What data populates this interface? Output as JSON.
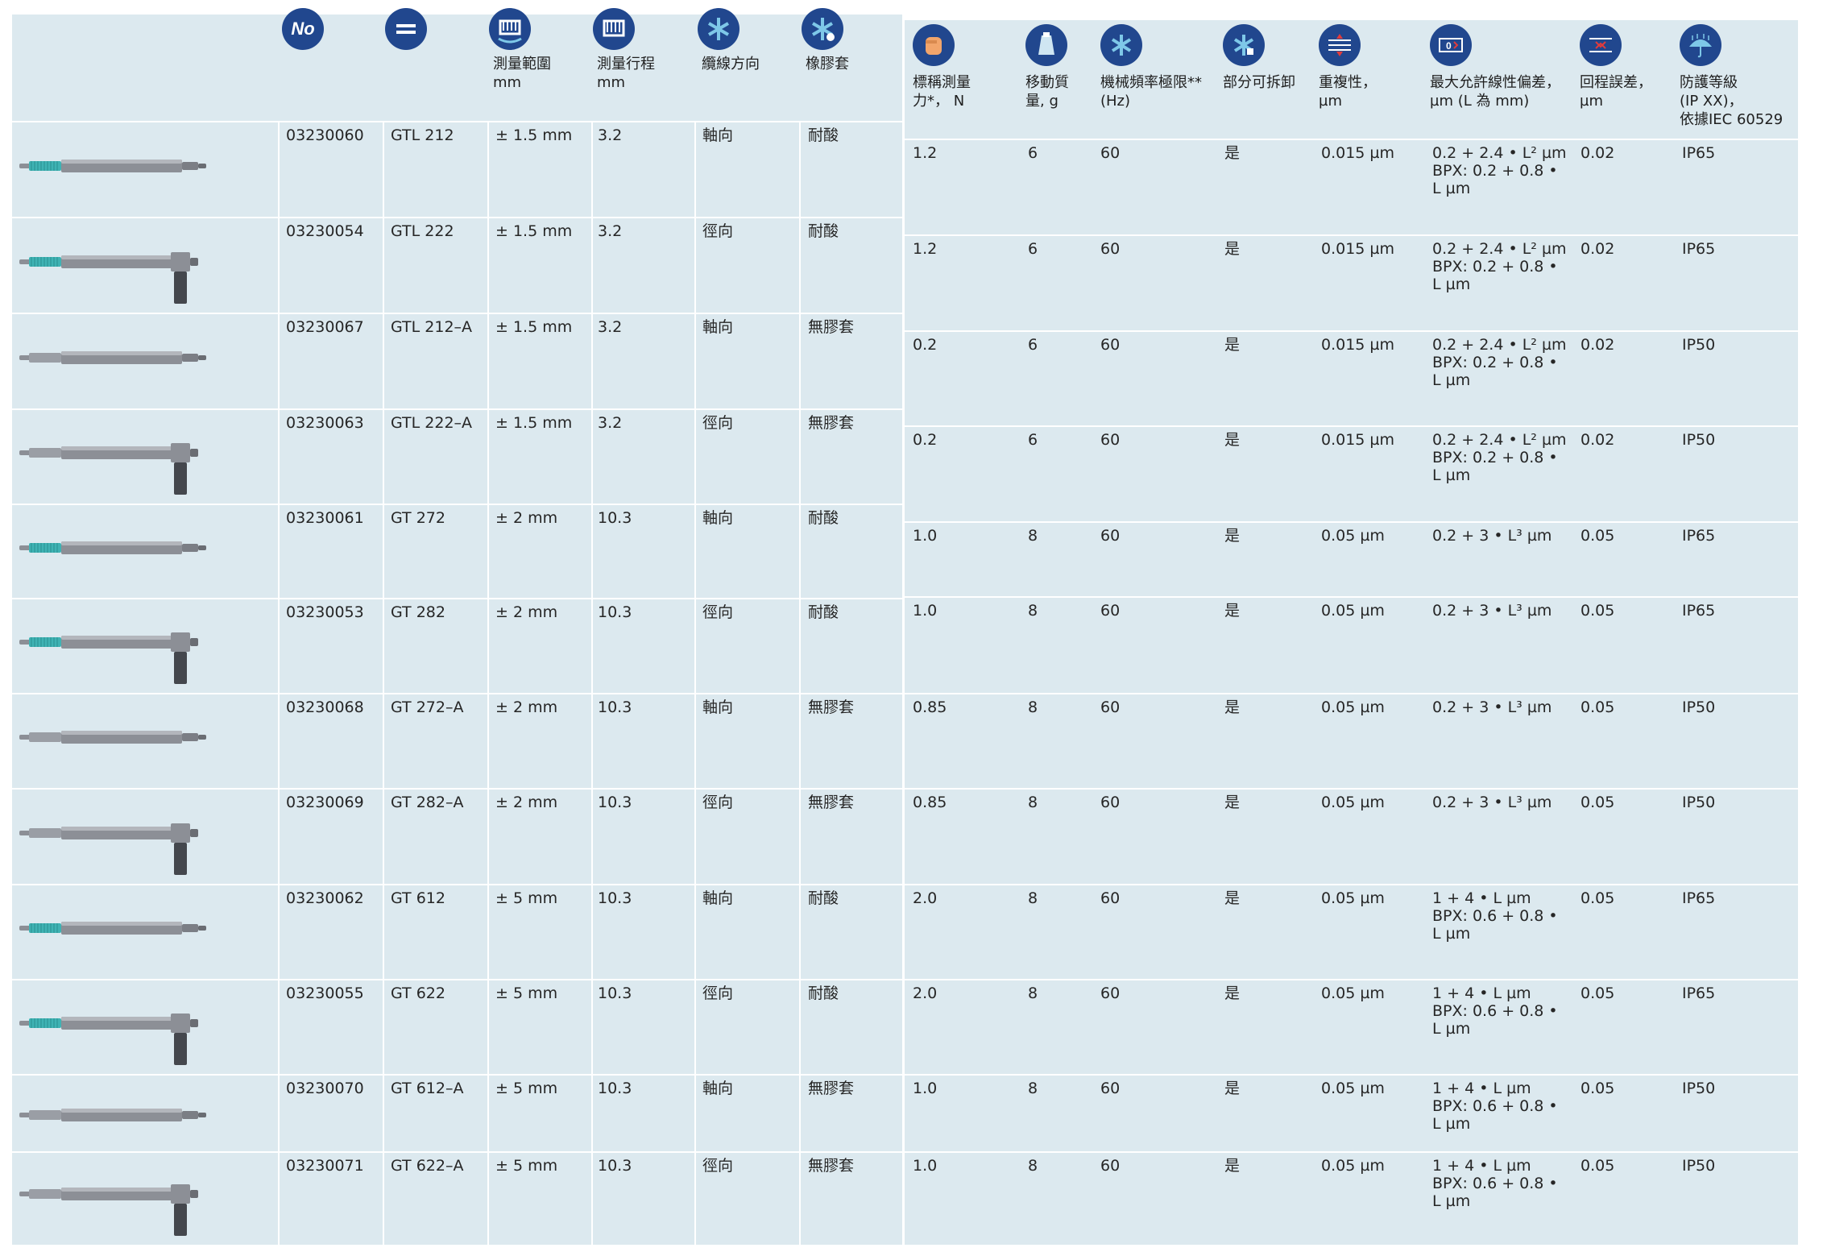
{
  "colors": {
    "panel": "#dce9ef",
    "icon": "#21478e",
    "gaiter": "#3fb3b4",
    "probe_body": "#8c8f96"
  },
  "icons": [
    "number-icon",
    "model-icon",
    "range-icon",
    "stroke-icon",
    "cable-icon",
    "gaiter-icon",
    "force-icon",
    "mass-icon",
    "frequency-icon",
    "removable-icon",
    "repeatability-icon",
    "linearity-icon",
    "hysteresis-icon",
    "protection-icon"
  ],
  "left_headers": {
    "range": "測量範圍\nmm",
    "stroke": "測量行程\nmm",
    "cable": "纜線方向",
    "gaiter": "橡膠套"
  },
  "right_headers": {
    "force": "標稱測量\n力*， N",
    "mass": "移動質\n量, g",
    "freq": "機械頻率極限**\n(Hz)",
    "removable": "部分可拆卸",
    "repeat": "重複性，\nµm",
    "linearity": "最大允許線性偏差，\nµm (L 為 mm)",
    "hysteresis": "回程誤差，\nµm",
    "protection": "防護等級\n(IP XX)，\n依據IEC 60529"
  },
  "rows": [
    {
      "no": "03230060",
      "model": "GTL 212",
      "range": "± 1.5 mm",
      "stroke": "3.2",
      "cable": "軸向",
      "gaiter": "耐酸",
      "force": "1.2",
      "mass": "6",
      "freq": "60",
      "removable": "是",
      "repeat": "0.015 µm",
      "linearity": "0.2 + 2.4 • L² µm\nBPX: 0.2 + 0.8 •\nL µm",
      "hysteresis": "0.02",
      "protection": "IP65",
      "probe_type": "axial",
      "gaiter_on": true
    },
    {
      "no": "03230054",
      "model": "GTL 222",
      "range": "± 1.5 mm",
      "stroke": "3.2",
      "cable": "徑向",
      "gaiter": "耐酸",
      "force": "1.2",
      "mass": "6",
      "freq": "60",
      "removable": "是",
      "repeat": "0.015 µm",
      "linearity": "0.2 + 2.4 • L² µm\nBPX: 0.2 + 0.8 •\nL µm",
      "hysteresis": "0.02",
      "protection": "IP65",
      "probe_type": "radial",
      "gaiter_on": true
    },
    {
      "no": "03230067",
      "model": "GTL 212–A",
      "range": "± 1.5 mm",
      "stroke": "3.2",
      "cable": "軸向",
      "gaiter": "無膠套",
      "force": "0.2",
      "mass": "6",
      "freq": "60",
      "removable": "是",
      "repeat": "0.015 µm",
      "linearity": "0.2 + 2.4 • L² µm\nBPX: 0.2 + 0.8 •\nL µm",
      "hysteresis": "0.02",
      "protection": "IP50",
      "probe_type": "axial",
      "gaiter_on": false
    },
    {
      "no": "03230063",
      "model": "GTL 222–A",
      "range": "± 1.5 mm",
      "stroke": "3.2",
      "cable": "徑向",
      "gaiter": "無膠套",
      "force": "0.2",
      "mass": "6",
      "freq": "60",
      "removable": "是",
      "repeat": "0.015 µm",
      "linearity": "0.2 + 2.4 • L² µm\nBPX: 0.2 + 0.8 •\nL µm",
      "hysteresis": "0.02",
      "protection": "IP50",
      "probe_type": "radial",
      "gaiter_on": false
    },
    {
      "no": "03230061",
      "model": "GT 272",
      "range": "± 2 mm",
      "stroke": "10.3",
      "cable": "軸向",
      "gaiter": "耐酸",
      "force": "1.0",
      "mass": "8",
      "freq": "60",
      "removable": "是",
      "repeat": "0.05 µm",
      "linearity": "0.2 + 3 • L³ µm",
      "hysteresis": "0.05",
      "protection": "IP65",
      "probe_type": "axial",
      "gaiter_on": true
    },
    {
      "no": "03230053",
      "model": "GT 282",
      "range": "± 2 mm",
      "stroke": "10.3",
      "cable": "徑向",
      "gaiter": "耐酸",
      "force": "1.0",
      "mass": "8",
      "freq": "60",
      "removable": "是",
      "repeat": "0.05 µm",
      "linearity": "0.2 + 3 • L³ µm",
      "hysteresis": "0.05",
      "protection": "IP65",
      "probe_type": "radial",
      "gaiter_on": true
    },
    {
      "no": "03230068",
      "model": "GT 272–A",
      "range": "± 2 mm",
      "stroke": "10.3",
      "cable": "軸向",
      "gaiter": "無膠套",
      "force": "0.85",
      "mass": "8",
      "freq": "60",
      "removable": "是",
      "repeat": "0.05 µm",
      "linearity": "0.2 + 3 • L³ µm",
      "hysteresis": "0.05",
      "protection": "IP50",
      "probe_type": "axial",
      "gaiter_on": false
    },
    {
      "no": "03230069",
      "model": "GT 282–A",
      "range": "± 2 mm",
      "stroke": "10.3",
      "cable": "徑向",
      "gaiter": "無膠套",
      "force": "0.85",
      "mass": "8",
      "freq": "60",
      "removable": "是",
      "repeat": "0.05 µm",
      "linearity": "0.2 + 3 • L³ µm",
      "hysteresis": "0.05",
      "protection": "IP50",
      "probe_type": "radial",
      "gaiter_on": false
    },
    {
      "no": "03230062",
      "model": "GT 612",
      "range": "± 5 mm",
      "stroke": "10.3",
      "cable": "軸向",
      "gaiter": "耐酸",
      "force": "2.0",
      "mass": "8",
      "freq": "60",
      "removable": "是",
      "repeat": "0.05 µm",
      "linearity": "1 + 4 • L µm\nBPX: 0.6 + 0.8 •\nL µm",
      "hysteresis": "0.05",
      "protection": "IP65",
      "probe_type": "axial",
      "gaiter_on": true
    },
    {
      "no": "03230055",
      "model": "GT 622",
      "range": "± 5 mm",
      "stroke": "10.3",
      "cable": "徑向",
      "gaiter": "耐酸",
      "force": "2.0",
      "mass": "8",
      "freq": "60",
      "removable": "是",
      "repeat": "0.05 µm",
      "linearity": "1 + 4 • L µm\nBPX: 0.6 + 0.8 •\nL µm",
      "hysteresis": "0.05",
      "protection": "IP65",
      "probe_type": "radial",
      "gaiter_on": true
    },
    {
      "no": "03230070",
      "model": "GT 612–A",
      "range": "± 5 mm",
      "stroke": "10.3",
      "cable": "軸向",
      "gaiter": "無膠套",
      "force": "1.0",
      "mass": "8",
      "freq": "60",
      "removable": "是",
      "repeat": "0.05 µm",
      "linearity": "1 + 4 • L µm\nBPX: 0.6 + 0.8 •\nL µm",
      "hysteresis": "0.05",
      "protection": "IP50",
      "probe_type": "axial",
      "gaiter_on": false
    },
    {
      "no": "03230071",
      "model": "GT 622–A",
      "range": "± 5 mm",
      "stroke": "10.3",
      "cable": "徑向",
      "gaiter": "無膠套",
      "force": "1.0",
      "mass": "8",
      "freq": "60",
      "removable": "是",
      "repeat": "0.05 µm",
      "linearity": "1 + 4 • L µm\nBPX: 0.6 + 0.8 •\nL µm",
      "hysteresis": "0.05",
      "protection": "IP50",
      "probe_type": "radial",
      "gaiter_on": false
    }
  ]
}
